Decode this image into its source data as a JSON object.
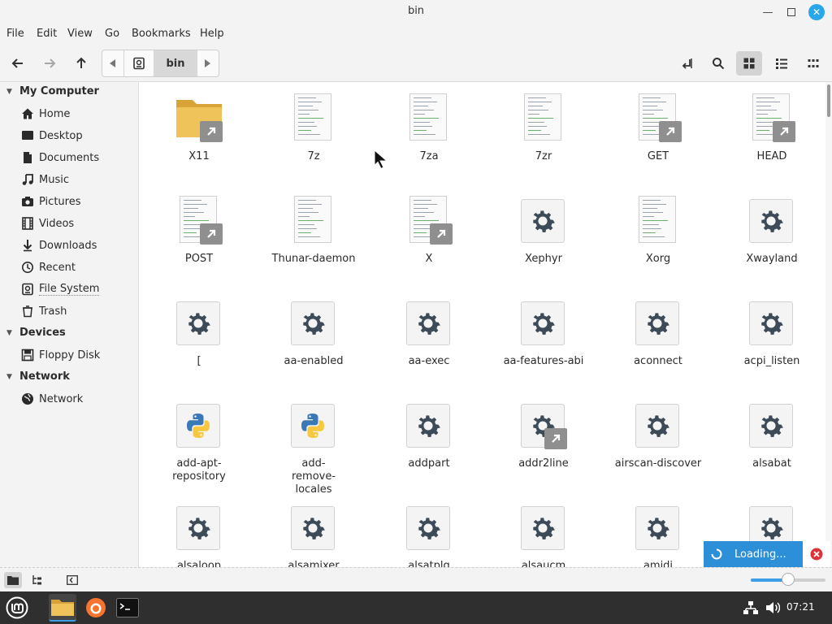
{
  "window": {
    "title": "bin"
  },
  "menubar": [
    "File",
    "Edit",
    "View",
    "Go",
    "Bookmarks",
    "Help"
  ],
  "pathbar": {
    "current": "bin"
  },
  "sidebar": {
    "sections": [
      {
        "title": "My Computer",
        "items": [
          {
            "label": "Home",
            "icon": "home-icon"
          },
          {
            "label": "Desktop",
            "icon": "desktop-icon"
          },
          {
            "label": "Documents",
            "icon": "document-icon"
          },
          {
            "label": "Music",
            "icon": "music-icon"
          },
          {
            "label": "Pictures",
            "icon": "camera-icon"
          },
          {
            "label": "Videos",
            "icon": "film-icon"
          },
          {
            "label": "Downloads",
            "icon": "download-icon"
          },
          {
            "label": "Recent",
            "icon": "clock-icon"
          },
          {
            "label": "File System",
            "icon": "drive-icon"
          },
          {
            "label": "Trash",
            "icon": "trash-icon"
          }
        ]
      },
      {
        "title": "Devices",
        "items": [
          {
            "label": "Floppy Disk",
            "icon": "floppy-icon"
          }
        ]
      },
      {
        "title": "Network",
        "items": [
          {
            "label": "Network",
            "icon": "globe-icon"
          }
        ]
      }
    ]
  },
  "files": [
    {
      "name": "X11",
      "type": "folder",
      "link": true
    },
    {
      "name": "7z",
      "type": "script",
      "link": false
    },
    {
      "name": "7za",
      "type": "script",
      "link": false
    },
    {
      "name": "7zr",
      "type": "script",
      "link": false
    },
    {
      "name": "GET",
      "type": "script",
      "link": true
    },
    {
      "name": "HEAD",
      "type": "script",
      "link": true
    },
    {
      "name": "POST",
      "type": "script",
      "link": true
    },
    {
      "name": "Thunar-daemon",
      "type": "script",
      "link": false
    },
    {
      "name": "X",
      "type": "script",
      "link": true
    },
    {
      "name": "Xephyr",
      "type": "executable",
      "link": false
    },
    {
      "name": "Xorg",
      "type": "script",
      "link": false
    },
    {
      "name": "Xwayland",
      "type": "executable",
      "link": false
    },
    {
      "name": "[",
      "type": "executable",
      "link": false
    },
    {
      "name": "aa-enabled",
      "type": "executable",
      "link": false
    },
    {
      "name": "aa-exec",
      "type": "executable",
      "link": false
    },
    {
      "name": "aa-features-abi",
      "type": "executable",
      "link": false
    },
    {
      "name": "aconnect",
      "type": "executable",
      "link": false
    },
    {
      "name": "acpi_listen",
      "type": "executable",
      "link": false
    },
    {
      "name": "add-apt-repository",
      "type": "python",
      "link": false
    },
    {
      "name": "add-remove-locales",
      "type": "python",
      "link": false
    },
    {
      "name": "addpart",
      "type": "executable",
      "link": false
    },
    {
      "name": "addr2line",
      "type": "executable",
      "link": true
    },
    {
      "name": "airscan-discover",
      "type": "executable",
      "link": false
    },
    {
      "name": "alsabat",
      "type": "executable",
      "link": false
    },
    {
      "name": "alsaloop",
      "type": "executable",
      "link": false
    },
    {
      "name": "alsamixer",
      "type": "executable",
      "link": false
    },
    {
      "name": "alsatplg",
      "type": "executable",
      "link": false
    },
    {
      "name": "alsaucm",
      "type": "executable",
      "link": false
    },
    {
      "name": "amidi",
      "type": "executable",
      "link": false
    },
    {
      "name": "",
      "type": "executable",
      "link": false
    }
  ],
  "status": {
    "loading": "Loading...",
    "zoom_level": 0.5
  },
  "taskbar": {
    "clock": "07:21"
  },
  "colors": {
    "accent": "#2d8fd8",
    "folder": "#f0c25a",
    "gear": "#3d4a57"
  }
}
